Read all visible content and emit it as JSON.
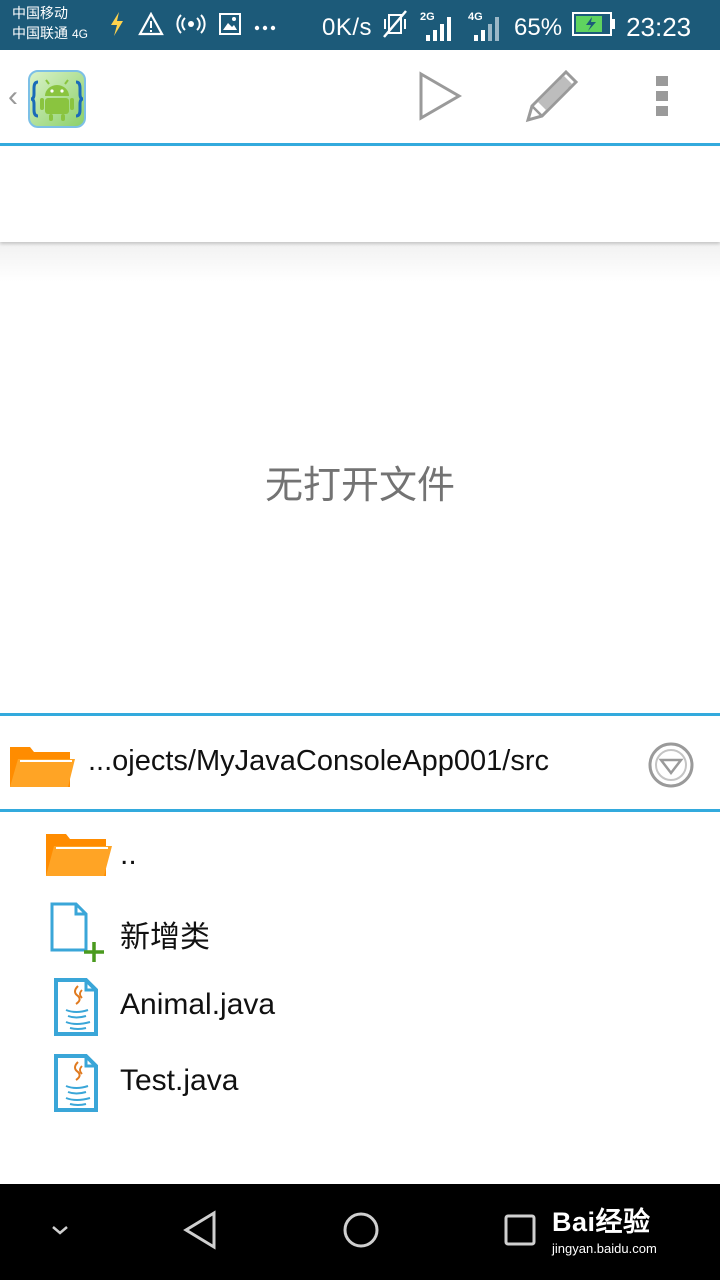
{
  "status_bar": {
    "carrier1": "中国移动",
    "carrier2": "中国联通",
    "carrier2_network": "4G",
    "net_speed": "0K/s",
    "sim1_tag": "2G",
    "sim2_tag": "4G",
    "battery_percent": "65%",
    "time": "23:23",
    "icons": [
      "charging-bolt-icon",
      "warning-icon",
      "hotspot-icon",
      "image-icon",
      "more-dots-icon",
      "vibrate-off-icon",
      "signal-icon",
      "battery-icon"
    ]
  },
  "toolbar": {
    "back_symbol": "‹",
    "actions": [
      "play-icon",
      "edit-pencil-icon",
      "overflow-menu-icon"
    ]
  },
  "editor": {
    "empty_message": "无打开文件"
  },
  "file_browser": {
    "path": "...ojects/MyJavaConsoleApp001/src",
    "items": [
      {
        "label": "..",
        "icon": "folder-icon"
      },
      {
        "label": "新增类",
        "icon": "new-file-icon"
      },
      {
        "label": "Animal.java",
        "icon": "java-file-icon"
      },
      {
        "label": "Test.java",
        "icon": "java-file-icon"
      }
    ]
  },
  "nav_bar": {
    "buttons": [
      "hide-nav-icon",
      "back-icon",
      "home-icon",
      "recents-icon"
    ],
    "watermark_main": "Bai经验",
    "watermark_sub": "jingyan.baidu.com"
  },
  "colors": {
    "status_bar": "#1c5a79",
    "accent": "#33aadd",
    "folder": "#ff8c00",
    "file_blue": "#3aa6d8",
    "new_plus": "#4a9a1e"
  }
}
